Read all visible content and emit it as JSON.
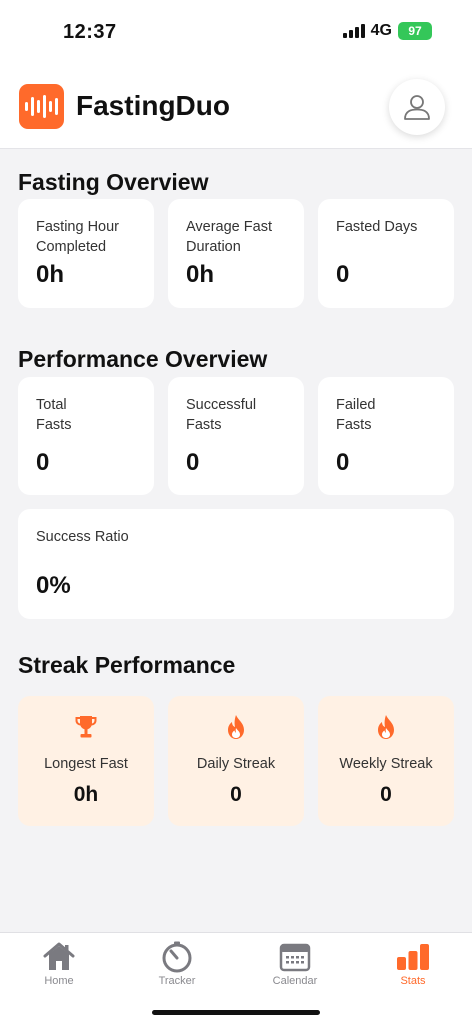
{
  "status_bar": {
    "time": "12:37",
    "network": "4G",
    "battery": "97"
  },
  "header": {
    "title": "FastingDuo",
    "logo_icon": "waveform-icon",
    "profile_icon": "user-icon"
  },
  "fasting_overview": {
    "title": "Fasting Overview",
    "cards": [
      {
        "label": "Fasting Hour Completed",
        "value": "0h"
      },
      {
        "label": "Average Fast Duration",
        "value": "0h"
      },
      {
        "label": "Fasted Days",
        "value": "0"
      }
    ]
  },
  "performance_overview": {
    "title": "Performance Overview",
    "cards": [
      {
        "label": "Total Fasts",
        "value": "0"
      },
      {
        "label": "Successful Fasts",
        "value": "0"
      },
      {
        "label": "Failed Fasts",
        "value": "0"
      }
    ],
    "ratio": {
      "label": "Success Ratio",
      "value": "0%"
    }
  },
  "streak_performance": {
    "title": "Streak Performance",
    "cards": [
      {
        "icon": "trophy-icon",
        "label": "Longest Fast",
        "value": "0h"
      },
      {
        "icon": "flame-icon",
        "label": "Daily Streak",
        "value": "0"
      },
      {
        "icon": "flame-icon",
        "label": "Weekly Streak",
        "value": "0"
      }
    ]
  },
  "tabbar": {
    "tabs": [
      {
        "label": "Home",
        "icon": "home-icon",
        "active": false
      },
      {
        "label": "Tracker",
        "icon": "timer-icon",
        "active": false
      },
      {
        "label": "Calendar",
        "icon": "calendar-icon",
        "active": false
      },
      {
        "label": "Stats",
        "icon": "bar-chart-icon",
        "active": true
      }
    ]
  },
  "colors": {
    "accent": "#ff6a2b",
    "streak_card_bg": "#fff1e4",
    "background": "#f3f3f5"
  }
}
